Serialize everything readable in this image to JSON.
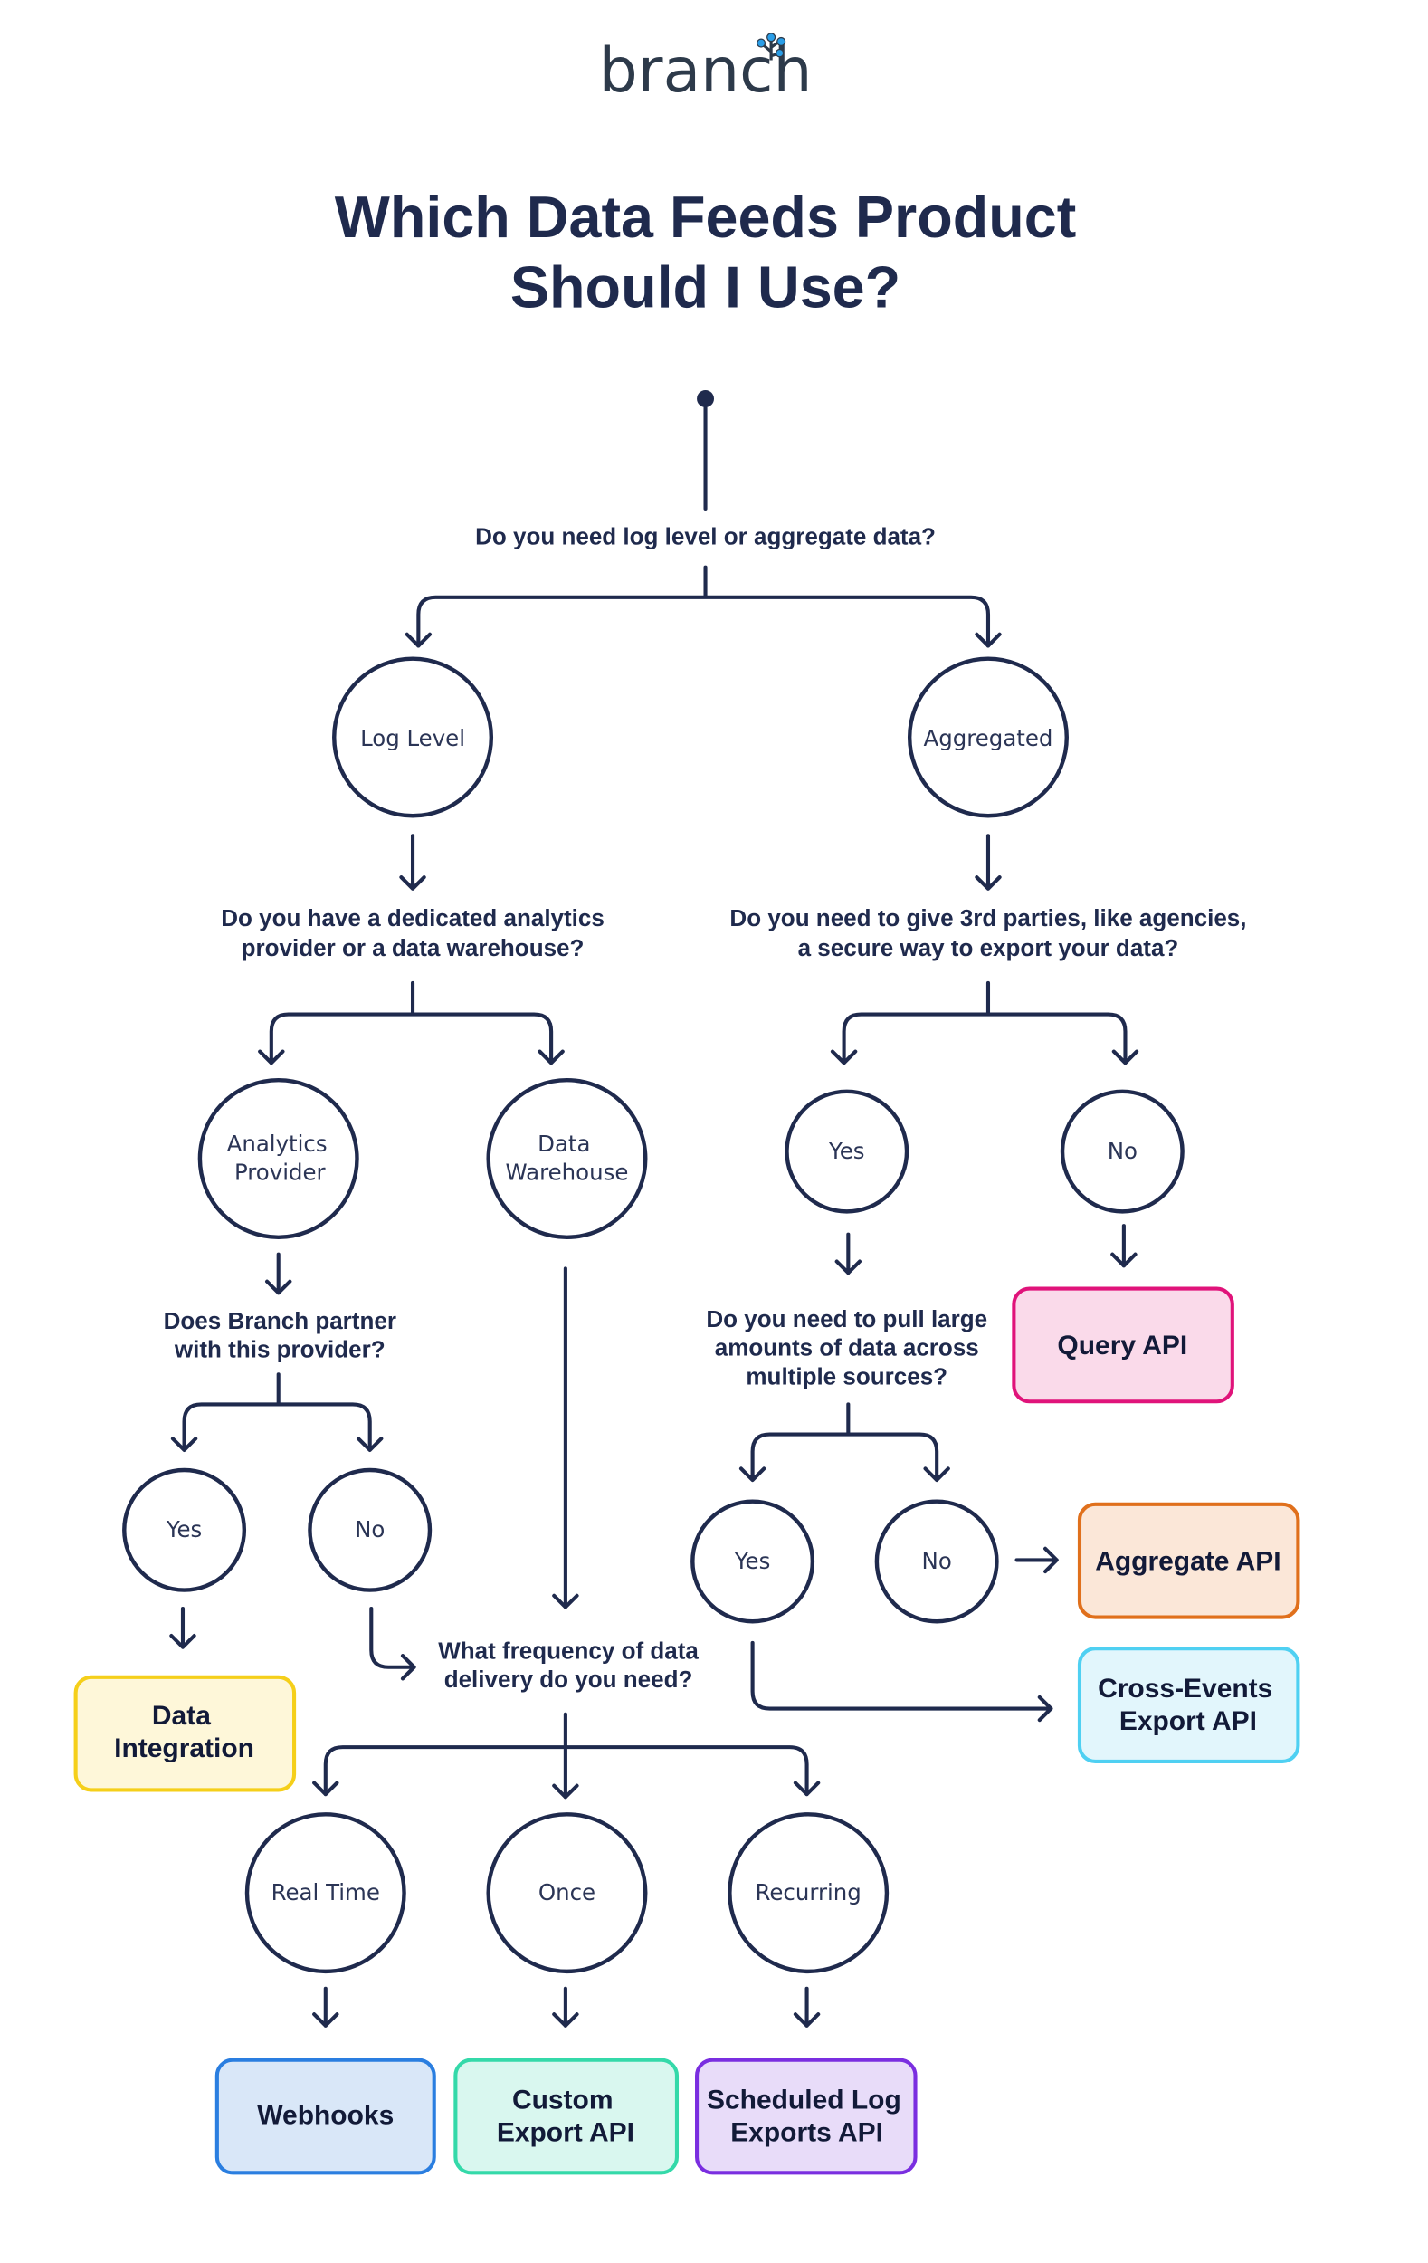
{
  "logo": {
    "text": "branch",
    "accent_color": "#2a9ee8"
  },
  "title": {
    "line1": "Which Data Feeds Product",
    "line2": "Should I Use?"
  },
  "questions": {
    "q1": {
      "lines": [
        "Do you need log level or aggregate data?"
      ]
    },
    "q2": {
      "lines": [
        "Do you have a dedicated analytics",
        "provider or a data warehouse?"
      ]
    },
    "q3": {
      "lines": [
        "Do you need to give 3rd parties, like agencies,",
        "a secure way to export your data?"
      ]
    },
    "q4": {
      "lines": [
        "Does Branch partner",
        "with this provider?"
      ]
    },
    "q5": {
      "lines": [
        "Do you need to pull large",
        "amounts of data across",
        "multiple sources?"
      ]
    },
    "q6": {
      "lines": [
        "What frequency of data",
        "delivery do you need?"
      ]
    }
  },
  "nodes": {
    "log_level": {
      "lines": [
        "Log Level"
      ]
    },
    "aggregated": {
      "lines": [
        "Aggregated"
      ]
    },
    "analytics_provider": {
      "lines": [
        "Analytics",
        "Provider"
      ]
    },
    "data_warehouse": {
      "lines": [
        "Data",
        "Warehouse"
      ]
    },
    "third_party_yes": {
      "lines": [
        "Yes"
      ]
    },
    "third_party_no": {
      "lines": [
        "No"
      ]
    },
    "partner_yes": {
      "lines": [
        "Yes"
      ]
    },
    "partner_no": {
      "lines": [
        "No"
      ]
    },
    "large_yes": {
      "lines": [
        "Yes"
      ]
    },
    "large_no": {
      "lines": [
        "No"
      ]
    },
    "real_time": {
      "lines": [
        "Real Time"
      ]
    },
    "once": {
      "lines": [
        "Once"
      ]
    },
    "recurring": {
      "lines": [
        "Recurring"
      ]
    }
  },
  "results": {
    "query_api": {
      "lines": [
        "Query API"
      ],
      "fill": "#fadaea",
      "stroke": "#e0137a"
    },
    "aggregate_api": {
      "lines": [
        "Aggregate API"
      ],
      "fill": "#fbe7d8",
      "stroke": "#e0701c"
    },
    "cross_events": {
      "lines": [
        "Cross-Events",
        "Export API"
      ],
      "fill": "#e2f6fc",
      "stroke": "#4fd0f2"
    },
    "data_integration": {
      "lines": [
        "Data",
        "Integration"
      ],
      "fill": "#fef7d9",
      "stroke": "#f5cf1a"
    },
    "webhooks": {
      "lines": [
        "Webhooks"
      ],
      "fill": "#d9e7f8",
      "stroke": "#2a7ee0"
    },
    "custom_export": {
      "lines": [
        "Custom",
        "Export API"
      ],
      "fill": "#d9f7ef",
      "stroke": "#34d9a9"
    },
    "scheduled_log": {
      "lines": [
        "Scheduled Log",
        "Exports API"
      ],
      "fill": "#e8dcf9",
      "stroke": "#7a2ee0"
    }
  }
}
